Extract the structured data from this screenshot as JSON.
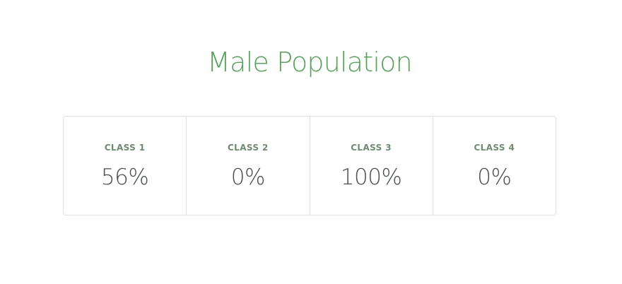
{
  "title": "Male Population",
  "colors": {
    "title": "#5aa05e",
    "label": "#6f8a72",
    "value": "#4a4f4b",
    "border": "#e2e2e2"
  },
  "stats": [
    {
      "label": "CLASS 1",
      "value": "56%"
    },
    {
      "label": "CLASS 2",
      "value": "0%"
    },
    {
      "label": "CLASS 3",
      "value": "100%"
    },
    {
      "label": "CLASS 4",
      "value": "0%"
    }
  ]
}
